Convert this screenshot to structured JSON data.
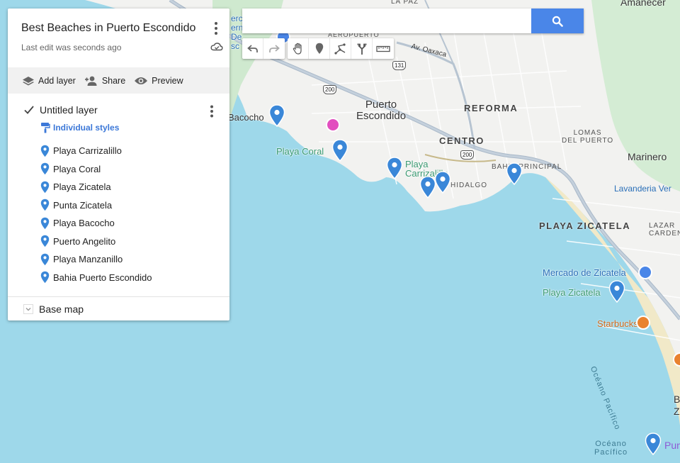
{
  "panel": {
    "title": "Best Beaches in Puerto Escondido",
    "last_edit": "Last edit was seconds ago",
    "actions": {
      "add_layer": "Add layer",
      "share": "Share",
      "preview": "Preview"
    },
    "layer": {
      "name": "Untitled layer",
      "checked": true,
      "styles_label": "Individual styles",
      "places": [
        "Playa Carrizalillo",
        "Playa Coral",
        "Playa Zicatela",
        "Punta Zicatela",
        "Playa Bacocho",
        "Puerto Angelito",
        "Playa Manzanillo",
        "Bahia Puerto Escondido"
      ]
    },
    "base_map": "Base map"
  },
  "search": {
    "value": "",
    "placeholder": ""
  },
  "toolbar": {
    "icons": [
      "undo-icon",
      "redo-icon",
      "hand-icon",
      "marker-icon",
      "draw-line-icon",
      "directions-icon",
      "ruler-icon"
    ]
  },
  "map": {
    "labels": {
      "amanecer": "Amanecer",
      "la_paz": "LA PAZ",
      "aeropuerto": "AEROPUERTO",
      "av_oaxaca": "Av. Oaxaca",
      "airport_fragment": "erc\nernacional\nDe\nsc",
      "puerto": "Puerto\nEscondido",
      "reforma": "REFORMA",
      "centro": "CENTRO",
      "lomas": "LOMAS\nDEL PUERTO",
      "marinero": "Marinero",
      "bacocho": "Bacocho",
      "playa_coral": "Playa Coral",
      "playa_carrizalillo": "Playa\nCarrizalillo",
      "hidalgo": "HIDALGO",
      "bahia_principal": "BAHIA PRINCIPAL",
      "lavanderia": "Lavanderia Ver",
      "playa_zicatela_district": "PLAYA ZICATELA",
      "lazaro": "LAZAR\nCARDEN",
      "mercado": "Mercado de Zicatela",
      "playa_zicatela": "Playa Zicatela",
      "starbucks": "Starbucks",
      "oceano_vertical": "Océano Pacífico",
      "oceano_bottom": "Océano\nPacífico",
      "pun": "Pun",
      "edge_letters": "B\nZ"
    },
    "shields": [
      "131",
      "200",
      "200"
    ],
    "colors": {
      "water": "#9ed8ea",
      "land": "#f2f2f0",
      "green": "#cfe9cf",
      "marker": "#3a87d8",
      "poi_pink": "#e24fbf",
      "poi_blue": "#4a86e8",
      "poi_orange": "#e9822e"
    }
  }
}
